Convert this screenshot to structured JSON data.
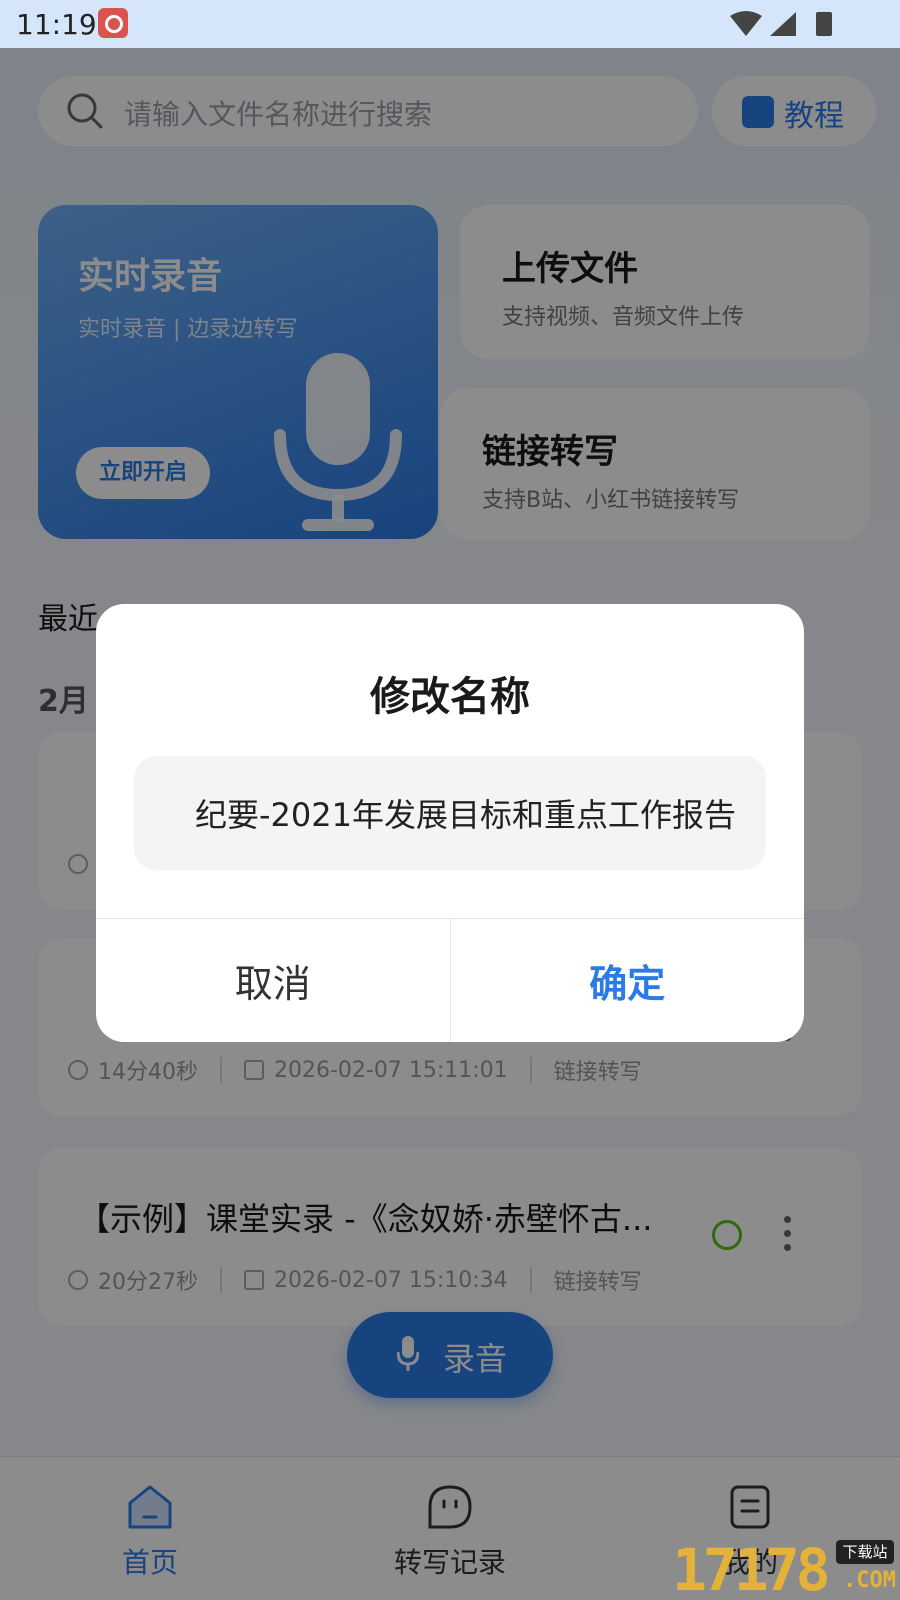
{
  "status_bar": {
    "time": "11:19"
  },
  "search": {
    "placeholder": "请输入文件名称进行搜索"
  },
  "tutorial": {
    "label": "教程"
  },
  "card_live": {
    "title": "实时录音",
    "subtitle": "实时录音 | 边录边转写",
    "button": "立即开启"
  },
  "card_upload": {
    "title": "上传文件",
    "subtitle": "支持视频、音频文件上传"
  },
  "card_link": {
    "title": "链接转写",
    "subtitle": "支持B站、小红书链接转写"
  },
  "recent": {
    "title": "最近",
    "month": "2月"
  },
  "records": [
    {
      "name": "",
      "duration": "",
      "date": "",
      "source": ""
    },
    {
      "name": "",
      "duration": "14分40秒",
      "date": "2026-02-07 15:11:01",
      "source": "链接转写"
    },
    {
      "name": "【示例】课堂实录 -《念奴娇·赤壁怀古...",
      "duration": "20分27秒",
      "date": "2026-02-07 15:10:34",
      "source": "链接转写"
    }
  ],
  "fab": {
    "label": "录音"
  },
  "tabs": [
    {
      "label": "首页",
      "icon": "home-icon",
      "active": true
    },
    {
      "label": "转写记录",
      "icon": "chat-icon",
      "active": false
    },
    {
      "label": "我的",
      "icon": "profile-icon",
      "active": false
    }
  ],
  "watermark": {
    "number": "17178",
    "badge": "下载站",
    "suffix": ".COM"
  },
  "dialog": {
    "title": "修改名称",
    "input_value": "纪要-2021年发展目标和重点工作报告",
    "cancel": "取消",
    "confirm": "确定"
  },
  "colors": {
    "accent": "#2b7be6",
    "success": "#52c41a"
  }
}
